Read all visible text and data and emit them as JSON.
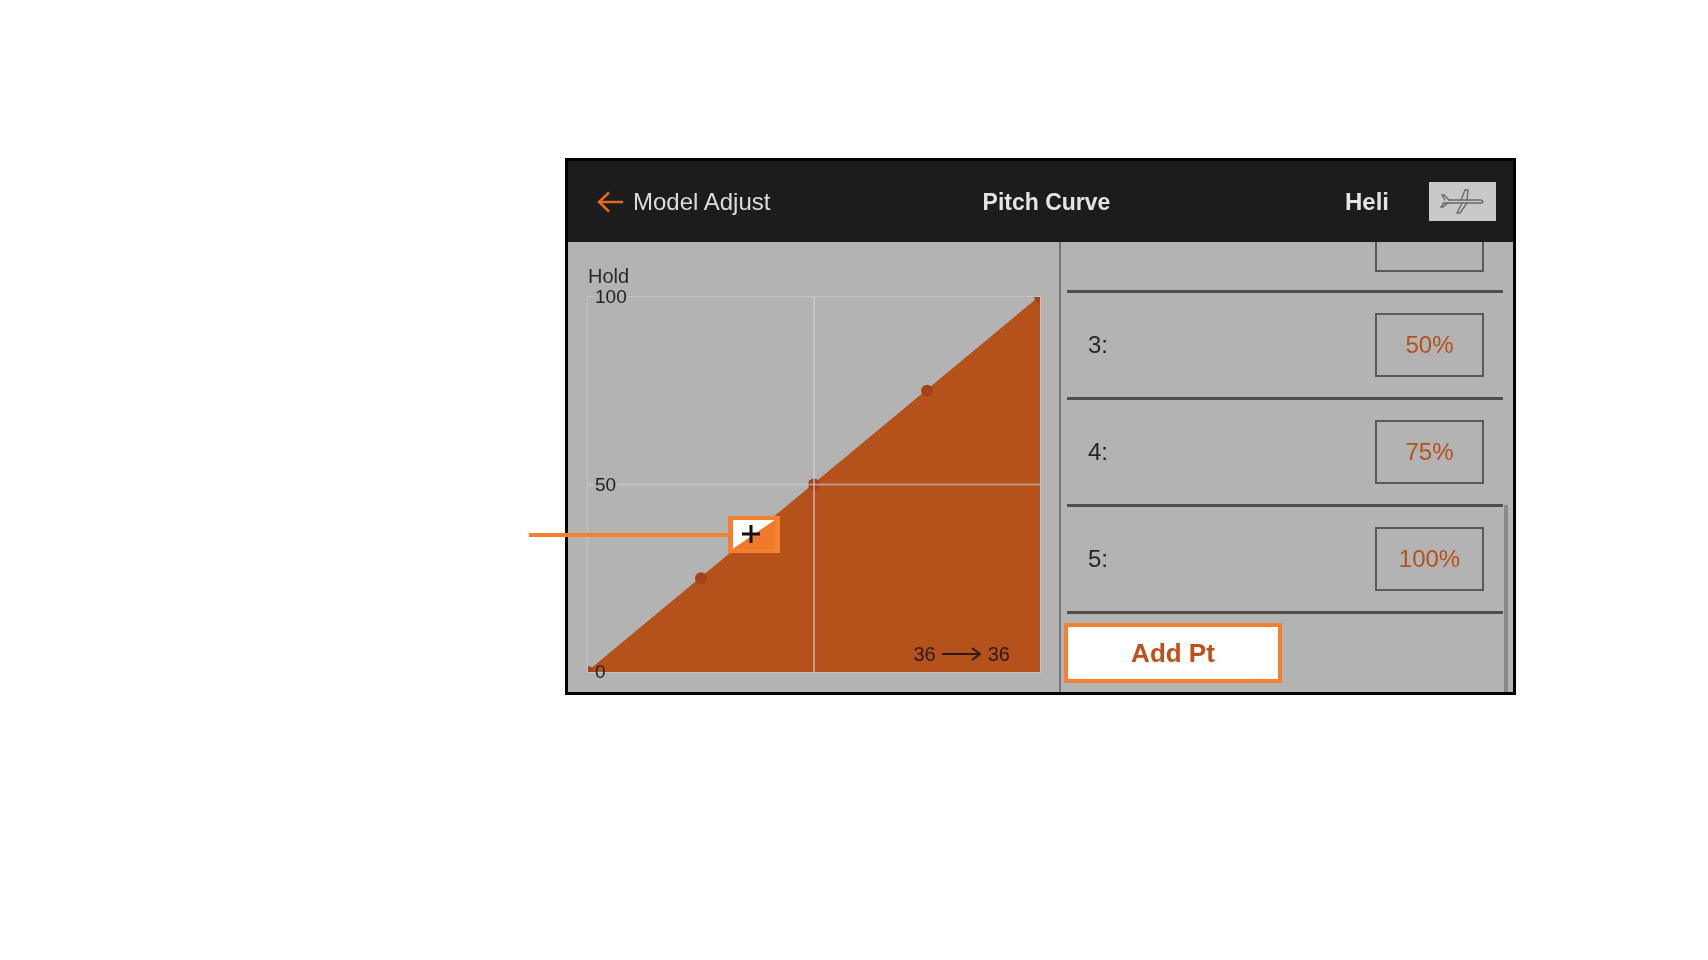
{
  "header": {
    "back_label": "Model Adjust",
    "title": "Pitch Curve",
    "model_type": "Heli"
  },
  "curve_panel": {
    "chart_data": {
      "type": "area",
      "title": "Hold",
      "categories": [
        null,
        null,
        null,
        null,
        null
      ],
      "series": [
        {
          "color": "#b5521b",
          "values": [
            0,
            25,
            50,
            75,
            100
          ]
        }
      ],
      "ylim": [
        0,
        100
      ],
      "yticks": [
        {
          "value": 0,
          "label": "0"
        },
        {
          "value": 50,
          "label": "50"
        },
        {
          "value": 100,
          "label": "100"
        }
      ]
    },
    "reading": {
      "input": "36",
      "output": "36"
    }
  },
  "points_list": {
    "points": [
      {
        "label": "3:",
        "value": "50%"
      },
      {
        "label": "4:",
        "value": "75%"
      },
      {
        "label": "5:",
        "value": "100%"
      }
    ]
  },
  "add_button": {
    "label": "Add Pt",
    "highlighted": true
  }
}
